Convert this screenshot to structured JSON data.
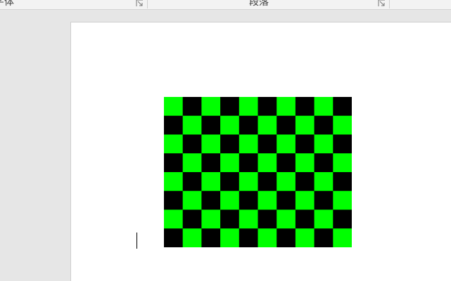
{
  "ribbon": {
    "groups": [
      {
        "label": "字体"
      },
      {
        "label": "段落"
      }
    ]
  },
  "document": {
    "image": {
      "description_name": "checkerboard",
      "rows": 8,
      "cols": 10,
      "colors": {
        "light": "#00ff00",
        "dark": "#000000"
      },
      "top_left_color": "light"
    }
  },
  "colors": {
    "workspace_bg": "#e6e6e6",
    "page_bg": "#ffffff",
    "ribbon_bg": "#f3f3f3"
  }
}
